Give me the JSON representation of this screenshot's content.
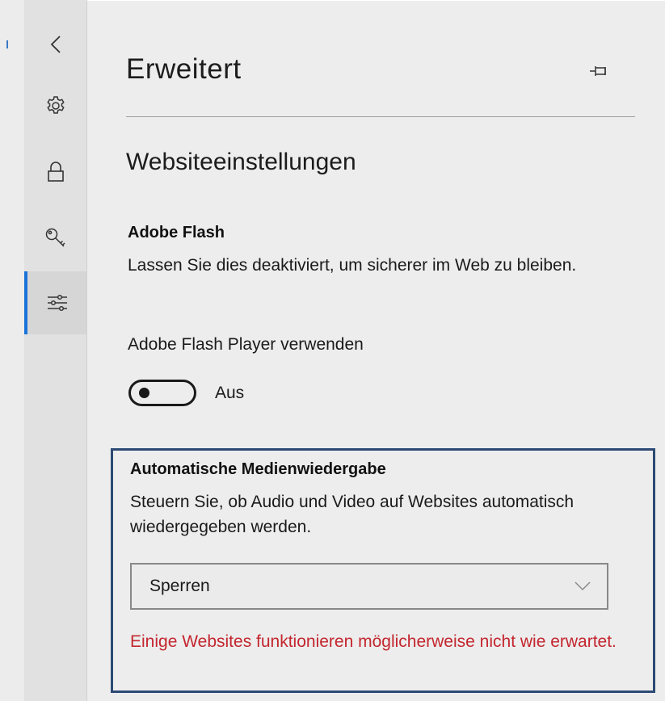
{
  "rail": {
    "items": [
      {
        "name": "back",
        "icon": "chevron-left-icon"
      },
      {
        "name": "settings",
        "icon": "gear-icon"
      },
      {
        "name": "privacy",
        "icon": "lock-icon"
      },
      {
        "name": "passwords",
        "icon": "key-icon"
      },
      {
        "name": "advanced",
        "icon": "sliders-icon",
        "active": true
      }
    ],
    "active_color": "#1a73d9"
  },
  "header": {
    "title": "Erweitert",
    "pin_icon": "pin-icon"
  },
  "section": {
    "title": "Websiteeinstellungen"
  },
  "flash": {
    "heading": "Adobe Flash",
    "description": "Lassen Sie dies deaktiviert, um sicherer im Web zu bleiben.",
    "player_label": "Adobe Flash Player verwenden",
    "toggle_state": "Aus",
    "toggle_on": false
  },
  "autoplay": {
    "heading": "Automatische Medienwiedergabe",
    "description": "Steuern Sie, ob Audio und Video auf Websites automatisch wiedergegeben werden.",
    "selected": "Sperren",
    "warning": "Einige Websites funktionieren möglicherweise nicht wie erwartet.",
    "warning_color": "#c4262e",
    "highlight_color": "#2c4a74"
  }
}
